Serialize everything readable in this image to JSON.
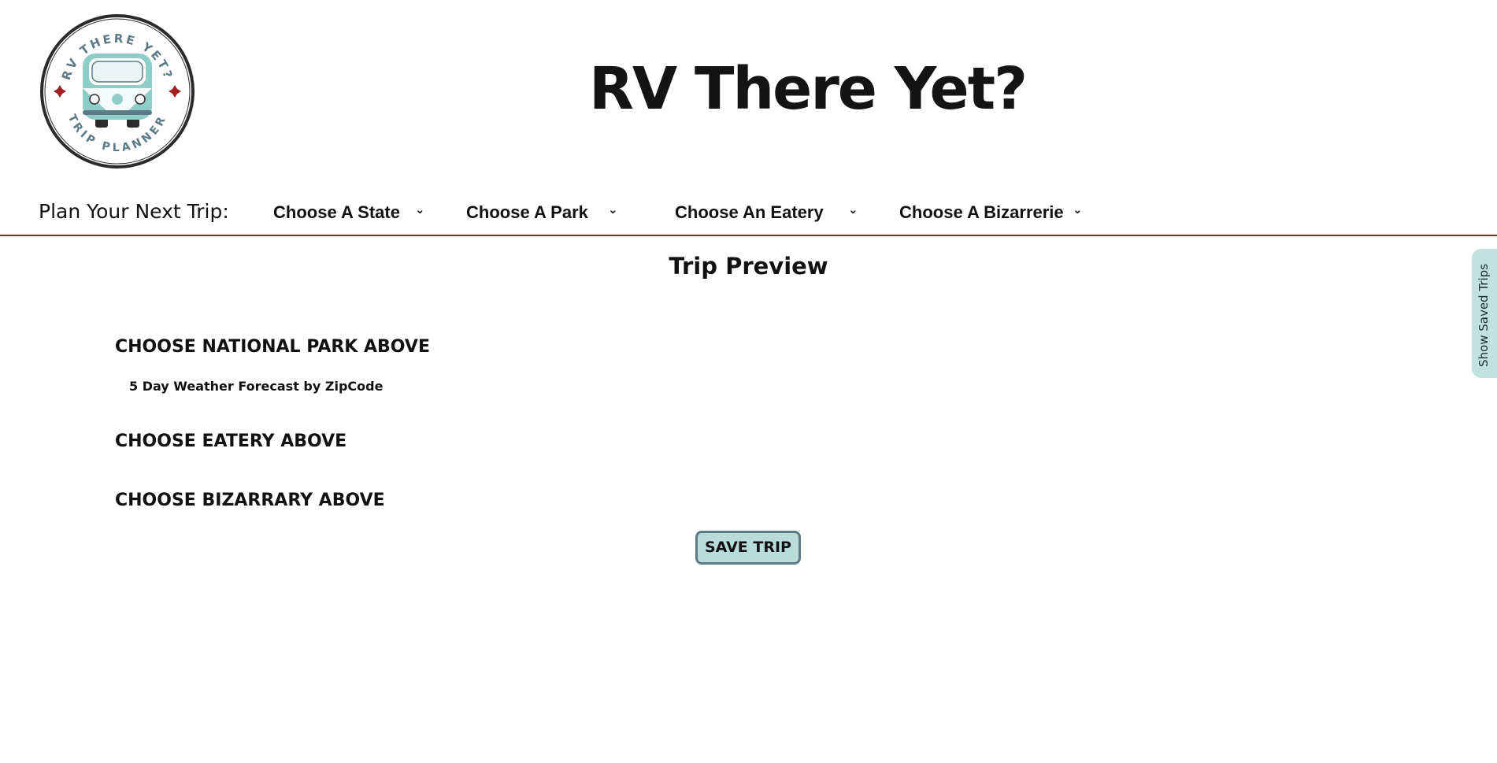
{
  "logo": {
    "top_text": "RV THERE YET?",
    "bottom_text": "TRIP PLANNER",
    "colors": {
      "van": "#8fcdc9",
      "star": "#a31f1f",
      "ring": "#2b2b2b",
      "text": "#5e7a86"
    }
  },
  "header": {
    "title": "RV There Yet?"
  },
  "nav": {
    "label": "Plan Your Next Trip:",
    "dropdowns": [
      {
        "label": "Choose A State",
        "icon": "chevron-down-icon"
      },
      {
        "label": "Choose A Park",
        "icon": "chevron-down-icon"
      },
      {
        "label": "Choose An Eatery",
        "icon": "chevron-down-icon"
      },
      {
        "label": "Choose A Bizarrerie",
        "icon": "chevron-down-icon"
      }
    ],
    "border_color": "#a31f1f"
  },
  "main": {
    "preview_title": "Trip Preview",
    "park_heading": "CHOOSE NATIONAL PARK ABOVE",
    "weather_label": "5 Day Weather Forecast by ZipCode",
    "eatery_heading": "CHOOSE EATERY ABOVE",
    "bizarre_heading": "CHOOSE BIZARRARY ABOVE",
    "save_button": "SAVE TRIP",
    "save_button_color": "#b9dcdb"
  },
  "side_tab": {
    "label": "Show Saved Trips",
    "color": "#c1e2dd"
  }
}
